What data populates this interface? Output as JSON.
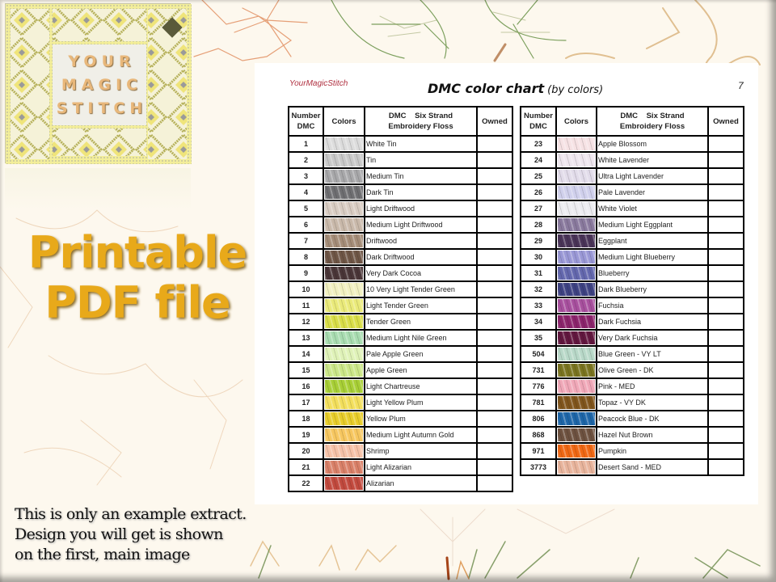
{
  "logo": {
    "lines": [
      "YOUR",
      "MAGIC",
      "STITCH"
    ]
  },
  "promo": {
    "line1": "Printable",
    "line2": "PDF file"
  },
  "disclaimer": {
    "line1": "This is only an example extract.",
    "line2": "Design you will get is shown",
    "line3": "on the first, main image"
  },
  "paper": {
    "brand": "YourMagicStitch",
    "title": "DMC color chart",
    "subtitle": "(by colors)",
    "page_number": "7"
  },
  "table_headers": {
    "number": [
      "Number",
      "DMC"
    ],
    "colors": "Colors",
    "floss": [
      "DMC    Six Strand",
      "Embroidery Floss"
    ],
    "owned": "Owned"
  },
  "left_table": [
    {
      "num": "1",
      "name": "White Tin",
      "color": "#dcdcdc"
    },
    {
      "num": "2",
      "name": "Tin",
      "color": "#c8c8c8"
    },
    {
      "num": "3",
      "name": "Medium Tin",
      "color": "#a8a8aa"
    },
    {
      "num": "4",
      "name": "Dark Tin",
      "color": "#6f6f72"
    },
    {
      "num": "5",
      "name": "Light Driftwood",
      "color": "#d8ccc2"
    },
    {
      "num": "6",
      "name": "Medium Light Driftwood",
      "color": "#c9b9aa"
    },
    {
      "num": "7",
      "name": "Driftwood",
      "color": "#a58d78"
    },
    {
      "num": "8",
      "name": "Dark Driftwood",
      "color": "#6f5646"
    },
    {
      "num": "9",
      "name": "Very Dark Cocoa",
      "color": "#4a3638"
    },
    {
      "num": "10",
      "name": "10 Very Light Tender Green",
      "color": "#f1f0c0"
    },
    {
      "num": "11",
      "name": "Light Tender Green",
      "color": "#eaea7a"
    },
    {
      "num": "12",
      "name": "Tender Green",
      "color": "#d9de48"
    },
    {
      "num": "13",
      "name": "Medium Light Nile Green",
      "color": "#a8dcb0"
    },
    {
      "num": "14",
      "name": "Pale Apple Green",
      "color": "#dff2b8"
    },
    {
      "num": "15",
      "name": "Apple Green",
      "color": "#cbe688"
    },
    {
      "num": "16",
      "name": "Light Chartreuse",
      "color": "#a8cf36"
    },
    {
      "num": "17",
      "name": "Light Yellow Plum",
      "color": "#f3df5c"
    },
    {
      "num": "18",
      "name": "Yellow Plum",
      "color": "#e8cd2a"
    },
    {
      "num": "19",
      "name": "Medium Light Autumn Gold",
      "color": "#f7c760"
    },
    {
      "num": "20",
      "name": "Shrimp",
      "color": "#f6c2a8"
    },
    {
      "num": "21",
      "name": "Light Alizarian",
      "color": "#d98068"
    },
    {
      "num": "22",
      "name": "Alizarian",
      "color": "#c24a3e"
    }
  ],
  "right_table": [
    {
      "num": "23",
      "name": "Apple Blossom",
      "color": "#f6e2e4"
    },
    {
      "num": "24",
      "name": "White Lavender",
      "color": "#eee6ee"
    },
    {
      "num": "25",
      "name": "Ultra Light Lavender",
      "color": "#e2dcea"
    },
    {
      "num": "26",
      "name": "Pale Lavender",
      "color": "#d0d0ec"
    },
    {
      "num": "27",
      "name": "White Violet",
      "color": "#ececf0"
    },
    {
      "num": "28",
      "name": "Medium Light Eggplant",
      "color": "#8a7a9e"
    },
    {
      "num": "29",
      "name": "Eggplant",
      "color": "#4a3458"
    },
    {
      "num": "30",
      "name": "Medium Light Blueberry",
      "color": "#9a98d6"
    },
    {
      "num": "31",
      "name": "Blueberry",
      "color": "#6468ae"
    },
    {
      "num": "32",
      "name": "Dark Blueberry",
      "color": "#3e4282"
    },
    {
      "num": "33",
      "name": "Fuchsia",
      "color": "#a8509e"
    },
    {
      "num": "34",
      "name": "Dark Fuchsia",
      "color": "#8c246c"
    },
    {
      "num": "35",
      "name": "Very Dark Fuchsia",
      "color": "#62173f"
    },
    {
      "num": "504",
      "name": "Blue Green - VY LT",
      "color": "#b8d8c8"
    },
    {
      "num": "731",
      "name": "Olive Green - DK",
      "color": "#7a7420"
    },
    {
      "num": "776",
      "name": "Pink - MED",
      "color": "#f0a8b8"
    },
    {
      "num": "781",
      "name": "Topaz - VY DK",
      "color": "#80551c"
    },
    {
      "num": "806",
      "name": "Peacock Blue - DK",
      "color": "#1e66a8"
    },
    {
      "num": "868",
      "name": "Hazel Nut Brown",
      "color": "#6e5240"
    },
    {
      "num": "971",
      "name": "Pumpkin",
      "color": "#f06814"
    },
    {
      "num": "3773",
      "name": "Desert Sand - MED",
      "color": "#e8b49c"
    }
  ]
}
